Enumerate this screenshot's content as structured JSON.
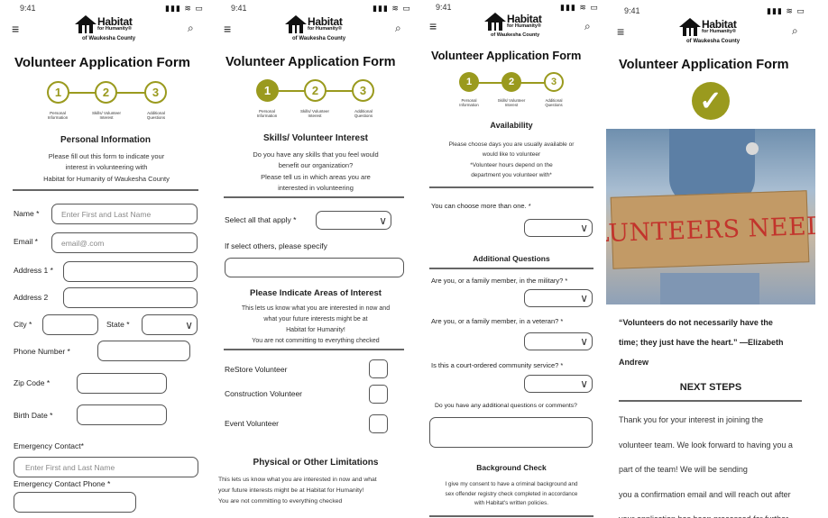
{
  "status": {
    "time": "9:41",
    "icons": "▮▮▮ ≋ ▭"
  },
  "header": {
    "menu_icon": "≡",
    "search_icon": "⌕",
    "logo_line1": "Habitat",
    "logo_line2": "for Humanity®",
    "logo_line3": "of Waukesha County"
  },
  "form_title": "Volunteer Application Form",
  "steps": [
    {
      "num": "1",
      "label": "Personal Information"
    },
    {
      "num": "2",
      "label": "Skills/ Volunteer Interest"
    },
    {
      "num": "3",
      "label": "Additional Questions"
    }
  ],
  "screen1": {
    "section_title": "Personal Information",
    "intro": [
      "Please fill out this form to indicate your",
      "interest in volunteering with",
      "Habitat for Humanity of Waukesha County"
    ],
    "name_label": "Name",
    "name_placeholder": "Enter First and Last Name",
    "email_label": "Email",
    "email_placeholder": "email@.com",
    "address1_label": "Address 1",
    "address2_label": "Address 2",
    "city_label": "City",
    "state_label": "State",
    "phone_label": "Phone Number",
    "zip_label": "Zip Code",
    "birth_label": "Birth Date",
    "emergency_label": "Emergency Contact",
    "emergency_placeholder": "Enter First and Last Name",
    "emergency_phone_label": "Emergency Contact Phone",
    "required": "*"
  },
  "screen2": {
    "section_title": "Skills/ Volunteer Interest",
    "intro": [
      "Do you have any skills that you feel would",
      "benefit our organization?",
      "Please tell us in which areas you are",
      "interested in volunteering"
    ],
    "select_label": "Select all that apply",
    "others_label": "If select others, please specify",
    "areas_title": "Please Indicate Areas of Interest",
    "areas_intro": [
      "This lets us know what you are interested in now and",
      "what your future interests might be at",
      "Habitat for Humanity!",
      "You are not committing to everything checked"
    ],
    "options": [
      "ReStore Volunteer",
      "Construction Volunteer",
      "Event Volunteer"
    ],
    "limits_title": "Physical or Other Limitations",
    "limits_intro": [
      "This lets us know what you are interested in now and what",
      "your future interests might be at Habitat for Humanity!",
      "You are not committing to everything checked"
    ]
  },
  "screen3": {
    "section_title": "Availability",
    "intro": [
      "Please choose days you are usually available or",
      "would like to volunteer",
      "*Volunteer hours depend on the",
      "department you volunteer with*"
    ],
    "choose_label": "You can choose more than one.",
    "additional_title": "Additional Questions",
    "q_military": "Are you, or a family member, in the military?",
    "q_veteran": "Are you, or a family member, in a veteran?",
    "q_court": "Is this a court-ordered community service?",
    "q_comments": "Do you have any additional questions or comments?",
    "bg_title": "Background Check",
    "bg_intro": [
      "I give my consent to have a criminal background and",
      "sex offender registry check completed in accordance",
      "with Habitat's written policies."
    ]
  },
  "screen4": {
    "sign_text": "VOLUNTEERS NEEDED",
    "quote_lines": [
      "“Volunteers do not necessarily have the",
      "time; they just have the heart.” —Elizabeth",
      "Andrew"
    ],
    "next_title": "NEXT STEPS",
    "body_lines": [
      "Thank you for your interest in joining the",
      "volunteer team. We look forward to having you a",
      "part of the team! We will be sending",
      "you a confirmation email and will reach out after",
      "your application has been processed for further"
    ]
  },
  "colors": {
    "accent": "#9a9a1e"
  }
}
